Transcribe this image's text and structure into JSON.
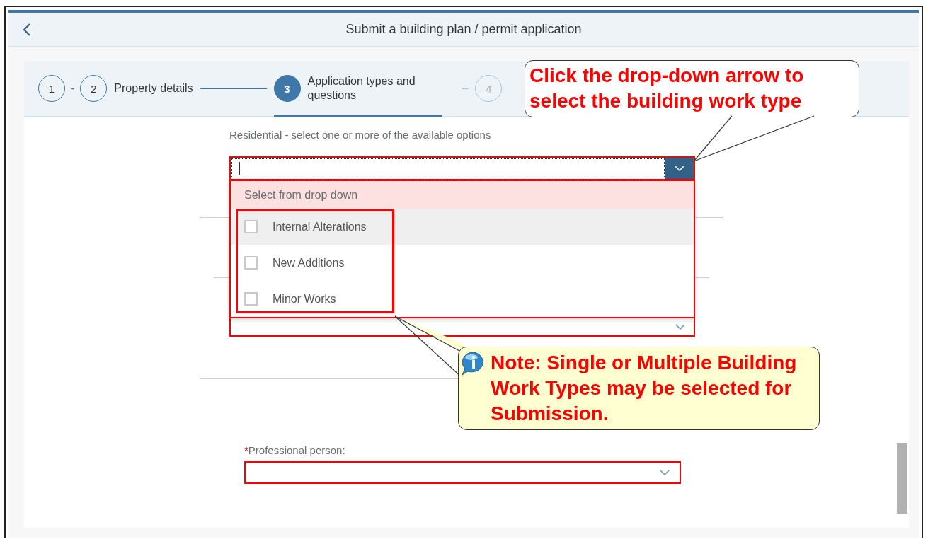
{
  "header": {
    "title": "Submit a building plan / permit application"
  },
  "steps": [
    {
      "number": "1",
      "selected": false,
      "disabled": false
    },
    {
      "number": "2",
      "label": "Property details",
      "before": "-",
      "selected": false,
      "disabled": false
    },
    {
      "number": "3",
      "label": "Application types and questions",
      "selected": true,
      "disabled": false
    },
    {
      "number": "4",
      "before": "–",
      "selected": false,
      "disabled": true
    }
  ],
  "form": {
    "residential_label": "Residential - select one or more of the available options",
    "work_type_dropdown": {
      "open": true,
      "list_header": "Select from drop down",
      "options": [
        {
          "label": "Internal Alterations",
          "checked": false,
          "highlighted": true
        },
        {
          "label": "New Additions",
          "checked": false,
          "highlighted": false
        },
        {
          "label": "Minor Works",
          "checked": false,
          "highlighted": false
        }
      ]
    },
    "professional_person": {
      "required_mark": "*",
      "label": "Professional person:"
    }
  },
  "annotations": [
    {
      "kind": "callout",
      "text": "Click the drop-down arrow to select the building work type"
    },
    {
      "kind": "note",
      "text": "Note: Single or Multiple Building Work Types may be selected for Submission."
    }
  ]
}
